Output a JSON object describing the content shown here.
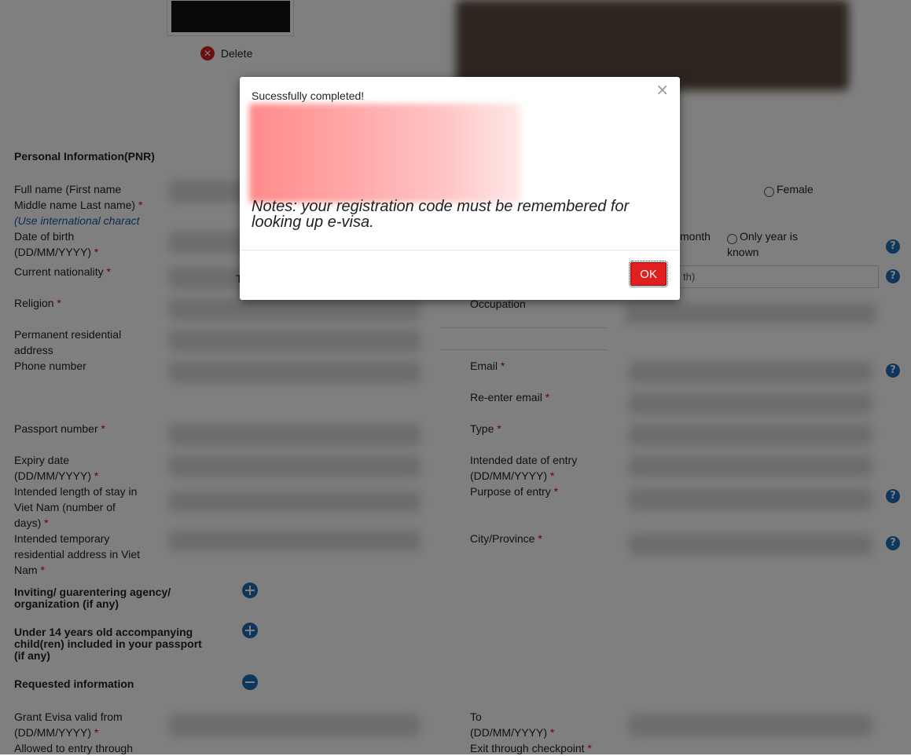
{
  "photo": {
    "delete_label": "Delete"
  },
  "personal": {
    "title": "Personal Information(PNR)",
    "full_name_label": "Full name (First name Middle name Last name)",
    "full_name_hint": "(Use international charact",
    "dob_label": "Date of birth (DD/MM/YYYY)",
    "nationality_label": "Current nationality",
    "religion_label": "Religion",
    "address_label": "Permanent residential address",
    "phone_label": "Phone number",
    "female_label": "Female",
    "month_label": "month",
    "only_year_label": "Only year is known",
    "birth_place_partial": "th)",
    "nationality_value_partial": "T",
    "occupation_label": "Occupation",
    "email_label": "Email",
    "reenter_email_label": "Re-enter email"
  },
  "passport": {
    "number_label": "Passport number",
    "expiry_label": "Expiry date (DD/MM/YYYY)",
    "type_label": "Type",
    "entry_date_label": "Intended date of entry (DD/MM/YYYY)",
    "stay_label": "Intended length of stay in Viet Nam (number of days)",
    "purpose_label": "Purpose of entry",
    "temp_address_label": "Intended temporary residential address in Viet Nam",
    "city_label": "City/Province"
  },
  "sections": {
    "inviting": "Inviting/ guarentering agency/ organization (if any)",
    "children": "Under 14 years old accompanying child(ren) included in your passport (if any)",
    "requested": "Requested information"
  },
  "requested": {
    "valid_from_label": "Grant Evisa valid from (DD/MM/YYYY)",
    "to_label": "To (DD/MM/YYYY)",
    "entry_checkpoint_label": "Allowed to entry through",
    "exit_checkpoint_label": "Exit through checkpoint"
  },
  "required_mark": "*",
  "help_glyph": "?",
  "modal": {
    "title": "Sucessfully completed!",
    "close_glyph": "×",
    "note": "Notes: your registration code must be remembered for looking up e-visa.",
    "ok_label": "OK"
  },
  "colors": {
    "ok_button": "#e02020",
    "required": "#dd0000",
    "help_icon": "#1e6fb7"
  }
}
